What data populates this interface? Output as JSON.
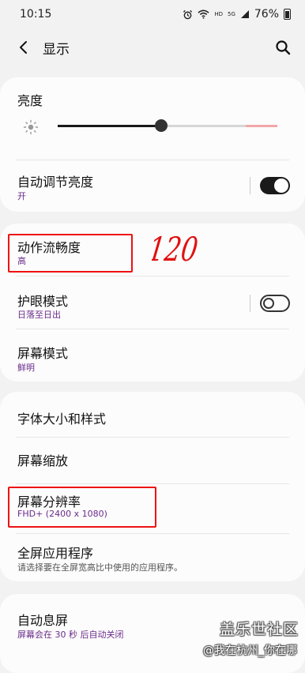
{
  "status_bar": {
    "time": "10:15",
    "hd_label": "HD",
    "network_label": "5G",
    "battery_percent": "76%",
    "battery_level": 0.76
  },
  "header": {
    "title": "显示"
  },
  "brightness": {
    "title": "亮度",
    "level": 0.47
  },
  "adaptive_brightness": {
    "title": "自动调节亮度",
    "value": "开",
    "toggle_on": true
  },
  "motion_smoothness": {
    "title": "动作流畅度",
    "value": "高"
  },
  "annotation_text": "120",
  "eye_comfort": {
    "title": "护眼模式",
    "value": "日落至日出",
    "toggle_on": false
  },
  "screen_mode": {
    "title": "屏幕模式",
    "value": "鲜明"
  },
  "font_size": {
    "title": "字体大小和样式"
  },
  "screen_zoom": {
    "title": "屏幕缩放"
  },
  "screen_resolution": {
    "title": "屏幕分辨率",
    "value": "FHD+ (2400 x 1080)"
  },
  "fullscreen_apps": {
    "title": "全屏应用程序",
    "description": "请选择要在全屏宽高比中使用的应用程序。"
  },
  "screen_timeout": {
    "title": "自动息屏",
    "value": "屏幕会在 30 秒 后自动关闭"
  },
  "watermark": {
    "brand": "盖乐世社区",
    "user": "@我在杭州_你在哪"
  },
  "colors": {
    "accent": "#6a2b8a",
    "annotation_red": "#e11111"
  }
}
